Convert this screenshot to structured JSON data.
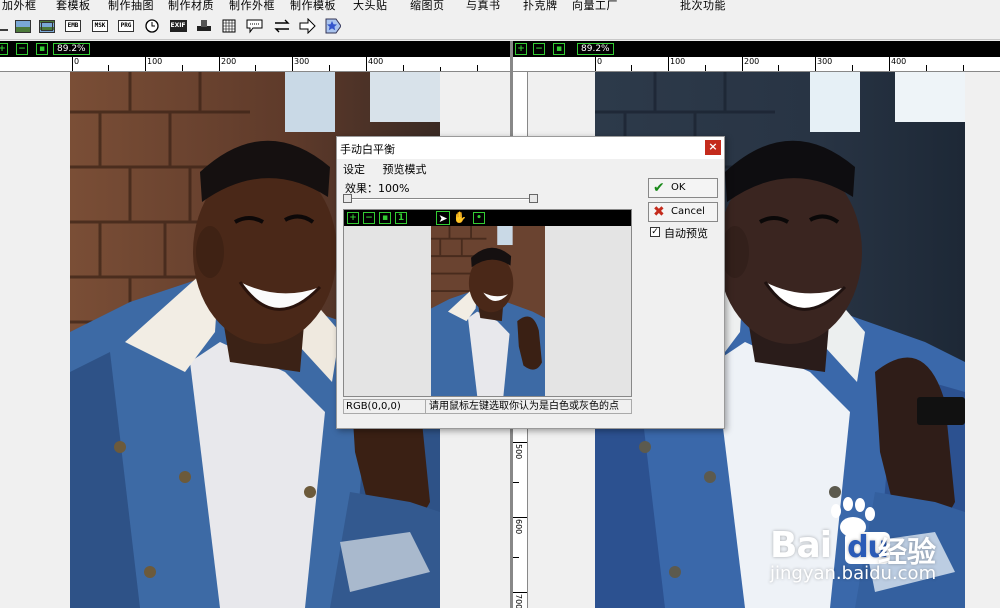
{
  "menu": [
    "加外框",
    "套模板",
    "制作抽图",
    "制作材质",
    "制作外框",
    "制作模板",
    "大头贴",
    "缩图页",
    "与真书",
    "扑克牌",
    "向量工厂",
    "批次功能"
  ],
  "toolbar": {
    "icons": [
      "crop-icon",
      "image-icon",
      "frame-icon",
      "emb-icon",
      "msk-icon",
      "prg-icon",
      "clock-icon",
      "exif-icon",
      "stamp-icon",
      "calendar-icon",
      "speech-icon",
      "swap-icon",
      "arrow-right-icon",
      "star-icon"
    ],
    "emb": "EMB",
    "msk": "MSK",
    "prg": "PRG",
    "exif": "EXIF"
  },
  "left_pane": {
    "zoom": "89.2%",
    "ruler_ticks": [
      "0",
      "100",
      "200",
      "300",
      "400"
    ]
  },
  "right_pane": {
    "zoom": "89.2%",
    "ruler_ticks": [
      "0",
      "100",
      "200",
      "300",
      "400"
    ],
    "v_ruler_ticks": [
      "500",
      "600",
      "700"
    ]
  },
  "dialog": {
    "title": "手动白平衡",
    "close": "×",
    "menu": [
      "设定",
      "预览模式"
    ],
    "effect_label": "效果：100%",
    "ok": "OK",
    "cancel": "Cancel",
    "auto_preview": "自动预览",
    "auto_preview_checked": true,
    "rgb": "RGB(0,0,0)",
    "hint": "请用鼠标左键选取你认为是白色或灰色的点"
  },
  "watermark": {
    "logo": "Bai",
    "logo_du": "du",
    "logo_cn": "经验",
    "url": "jingyan.baidu.com"
  },
  "colors": {
    "pane_bar": "#000000",
    "zoom_green": "#33cc33",
    "close_red": "#c42b1c"
  }
}
